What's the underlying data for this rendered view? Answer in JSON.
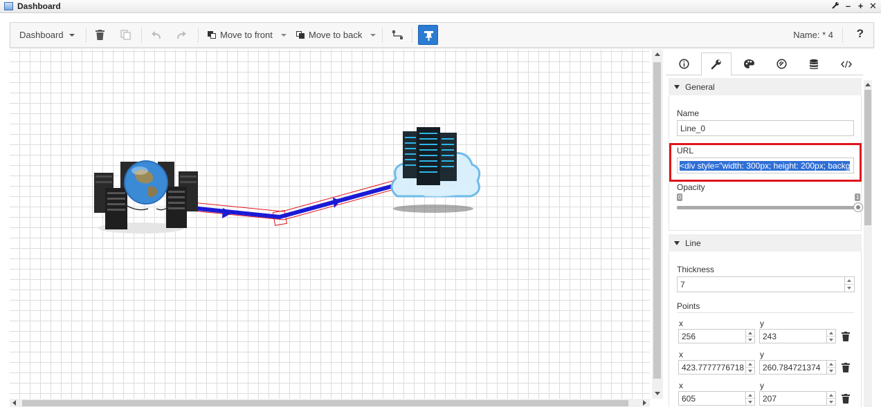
{
  "window": {
    "title": "Dashboard",
    "buttons": [
      "wrench-icon",
      "minimize-icon",
      "maximize-icon",
      "close-icon"
    ]
  },
  "toolbar": {
    "dashboard_menu": "Dashboard",
    "move_to_front": "Move to front",
    "move_to_back": "Move to back",
    "name_label": "Name: * 4",
    "help": "?",
    "pin_color": "#2b7bd3"
  },
  "canvas": {
    "line_color": "#1a1ad6",
    "selection_color": "#e0141c"
  },
  "panel": {
    "tabs": [
      "info-icon",
      "wrench-icon",
      "palette-icon",
      "link-icon",
      "database-icon",
      "code-icon"
    ],
    "active_tab": "wrench-icon",
    "general": {
      "header": "General",
      "name_label": "Name",
      "name_value": "Line_0",
      "url_label": "URL",
      "url_value": "<div style=\"width: 300px; height: 200px; backg",
      "opacity_label": "Opacity",
      "opacity_min": "0",
      "opacity_max": "1",
      "opacity_value": 1
    },
    "line": {
      "header": "Line",
      "thickness_label": "Thickness",
      "thickness_value": "7",
      "points_label": "Points",
      "x_label": "x",
      "y_label": "y",
      "points": [
        {
          "x": "256",
          "y": "243"
        },
        {
          "x": "423.7777776718",
          "y": "260.784721374"
        },
        {
          "x": "605",
          "y": "207"
        }
      ]
    }
  }
}
